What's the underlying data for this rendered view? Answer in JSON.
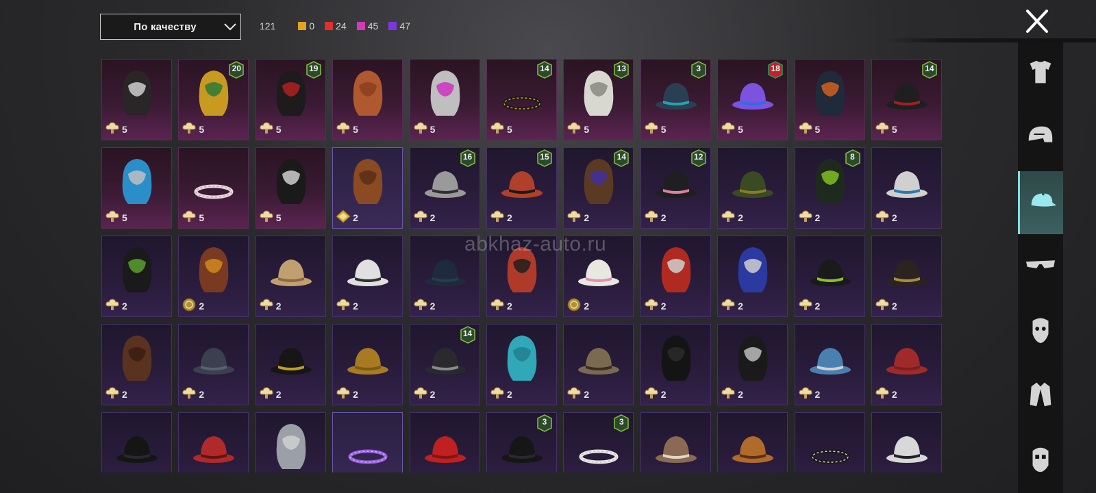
{
  "sort": {
    "label": "По качеству"
  },
  "counts": {
    "total": "121",
    "rarities": [
      {
        "color": "#e2a320",
        "value": "0"
      },
      {
        "color": "#e0302e",
        "value": "24"
      },
      {
        "color": "#d43ab8",
        "value": "45"
      },
      {
        "color": "#7a36e0",
        "value": "47"
      }
    ]
  },
  "watermark": "abkhaz-auto.ru",
  "items": [
    {
      "rarity": "red",
      "art": "dark-hair-bow",
      "qty": "5",
      "currency": "cloud",
      "badge": ""
    },
    {
      "rarity": "red",
      "art": "golden-mask",
      "qty": "5",
      "currency": "cloud",
      "badge": "20"
    },
    {
      "rarity": "red",
      "art": "black-hair-ribbon",
      "qty": "5",
      "currency": "cloud",
      "badge": "19"
    },
    {
      "rarity": "red",
      "art": "ginger-cat-ears",
      "qty": "5",
      "currency": "cloud",
      "badge": ""
    },
    {
      "rarity": "red",
      "art": "pink-visor-helmet",
      "qty": "5",
      "currency": "cloud",
      "badge": ""
    },
    {
      "rarity": "red",
      "art": "gold-band-hair",
      "qty": "5",
      "currency": "cloud",
      "badge": "14"
    },
    {
      "rarity": "red",
      "art": "white-mech-helmet",
      "qty": "5",
      "currency": "cloud",
      "badge": "13"
    },
    {
      "rarity": "red",
      "art": "tassel-hat",
      "qty": "5",
      "currency": "cloud",
      "badge": "3"
    },
    {
      "rarity": "red",
      "art": "purple-cap-headphones",
      "qty": "5",
      "currency": "cloud",
      "badge": "18"
    },
    {
      "rarity": "red",
      "art": "feather-crown",
      "qty": "5",
      "currency": "cloud",
      "badge": ""
    },
    {
      "rarity": "red",
      "art": "officer-cap-dark",
      "qty": "5",
      "currency": "cloud",
      "badge": "14"
    },
    {
      "rarity": "red",
      "art": "blue-spiky-beast",
      "qty": "5",
      "currency": "cloud",
      "badge": ""
    },
    {
      "rarity": "red",
      "art": "bunny-headband",
      "qty": "5",
      "currency": "cloud",
      "badge": ""
    },
    {
      "rarity": "red",
      "art": "skull-balaclava",
      "qty": "5",
      "currency": "cloud",
      "badge": ""
    },
    {
      "rarity": "violet",
      "art": "long-brown-hair",
      "qty": "2",
      "currency": "diamond",
      "badge": ""
    },
    {
      "rarity": "purple",
      "art": "beanie-goggles",
      "qty": "2",
      "currency": "cloud",
      "badge": "16"
    },
    {
      "rarity": "purple",
      "art": "red-hair-beanie",
      "qty": "2",
      "currency": "cloud",
      "badge": "15"
    },
    {
      "rarity": "purple",
      "art": "cat-hair-clip",
      "qty": "2",
      "currency": "cloud",
      "badge": "14"
    },
    {
      "rarity": "purple",
      "art": "bunny-ears-hat",
      "qty": "2",
      "currency": "cloud",
      "badge": "12"
    },
    {
      "rarity": "purple",
      "art": "olive-officer-cap",
      "qty": "2",
      "currency": "cloud",
      "badge": ""
    },
    {
      "rarity": "purple",
      "art": "green-skull-hood",
      "qty": "2",
      "currency": "cloud",
      "badge": "8"
    },
    {
      "rarity": "purple",
      "art": "blue-baseball-cap",
      "qty": "2",
      "currency": "cloud",
      "badge": ""
    },
    {
      "rarity": "purple",
      "art": "gas-mask-hood",
      "qty": "2",
      "currency": "cloud",
      "badge": ""
    },
    {
      "rarity": "purple",
      "art": "aviator-goggles-hair",
      "qty": "2",
      "currency": "coin",
      "badge": ""
    },
    {
      "rarity": "purple",
      "art": "bunny-safari-hat",
      "qty": "2",
      "currency": "cloud",
      "badge": ""
    },
    {
      "rarity": "purple",
      "art": "white-sun-hat",
      "qty": "2",
      "currency": "cloud",
      "badge": ""
    },
    {
      "rarity": "purple",
      "art": "navy-beanie",
      "qty": "2",
      "currency": "cloud",
      "badge": ""
    },
    {
      "rarity": "purple",
      "art": "red-hair-bucket",
      "qty": "2",
      "currency": "cloud",
      "badge": ""
    },
    {
      "rarity": "purple",
      "art": "flower-sun-hat",
      "qty": "2",
      "currency": "coin",
      "badge": ""
    },
    {
      "rarity": "purple",
      "art": "red-racing-helmet",
      "qty": "2",
      "currency": "cloud",
      "badge": ""
    },
    {
      "rarity": "purple",
      "art": "blue-batting-helmet",
      "qty": "2",
      "currency": "cloud",
      "badge": ""
    },
    {
      "rarity": "purple",
      "art": "green-black-cap",
      "qty": "2",
      "currency": "cloud",
      "badge": ""
    },
    {
      "rarity": "purple",
      "art": "steampunk-hat",
      "qty": "2",
      "currency": "cloud",
      "badge": ""
    },
    {
      "rarity": "purple",
      "art": "brown-bob-hair",
      "qty": "2",
      "currency": "cloud",
      "badge": ""
    },
    {
      "rarity": "purple",
      "art": "grey-baseball-cap",
      "qty": "2",
      "currency": "cloud",
      "badge": ""
    },
    {
      "rarity": "purple",
      "art": "black-fedora",
      "qty": "2",
      "currency": "cloud",
      "badge": ""
    },
    {
      "rarity": "purple",
      "art": "mustard-beanie",
      "qty": "2",
      "currency": "cloud",
      "badge": ""
    },
    {
      "rarity": "purple",
      "art": "sequin-police-cap",
      "qty": "2",
      "currency": "cloud",
      "badge": "14"
    },
    {
      "rarity": "purple",
      "art": "cyan-curly-hair",
      "qty": "2",
      "currency": "cloud",
      "badge": ""
    },
    {
      "rarity": "purple",
      "art": "scarecrow-hat",
      "qty": "2",
      "currency": "cloud",
      "badge": ""
    },
    {
      "rarity": "purple",
      "art": "black-balaclava",
      "qty": "2",
      "currency": "cloud",
      "badge": ""
    },
    {
      "rarity": "purple",
      "art": "wrestler-mask",
      "qty": "2",
      "currency": "cloud",
      "badge": ""
    },
    {
      "rarity": "purple",
      "art": "shark-hat",
      "qty": "2",
      "currency": "cloud",
      "badge": ""
    },
    {
      "rarity": "purple",
      "art": "red-beret",
      "qty": "2",
      "currency": "cloud",
      "badge": ""
    },
    {
      "rarity": "purple",
      "art": "black-top-hat",
      "qty": "",
      "currency": "",
      "badge": ""
    },
    {
      "rarity": "purple",
      "art": "red-fedora",
      "qty": "",
      "currency": "",
      "badge": ""
    },
    {
      "rarity": "purple",
      "art": "grey-shark-head",
      "qty": "",
      "currency": "",
      "badge": ""
    },
    {
      "rarity": "violet",
      "art": "purple-flower-wreath",
      "qty": "",
      "currency": "",
      "badge": ""
    },
    {
      "rarity": "purple",
      "art": "red-bucket-hat",
      "qty": "",
      "currency": "",
      "badge": ""
    },
    {
      "rarity": "purple",
      "art": "black-bowler",
      "qty": "",
      "currency": "",
      "badge": "3"
    },
    {
      "rarity": "purple",
      "art": "white-flower-wreath",
      "qty": "",
      "currency": "",
      "badge": "3"
    },
    {
      "rarity": "purple",
      "art": "cupcake-hat",
      "qty": "",
      "currency": "",
      "badge": ""
    },
    {
      "rarity": "purple",
      "art": "burger-hat",
      "qty": "",
      "currency": "",
      "badge": ""
    },
    {
      "rarity": "purple",
      "art": "headlamp-band",
      "qty": "",
      "currency": "",
      "badge": ""
    },
    {
      "rarity": "purple",
      "art": "white-captain-cap",
      "qty": "",
      "currency": "",
      "badge": ""
    }
  ],
  "sidebar": [
    {
      "name": "outfit-icon",
      "active": false
    },
    {
      "name": "helmet-icon",
      "active": false
    },
    {
      "name": "cap-icon",
      "active": true
    },
    {
      "name": "glasses-icon",
      "active": false
    },
    {
      "name": "mask-icon",
      "active": false
    },
    {
      "name": "jacket-icon",
      "active": false
    },
    {
      "name": "face-icon",
      "active": false
    }
  ]
}
